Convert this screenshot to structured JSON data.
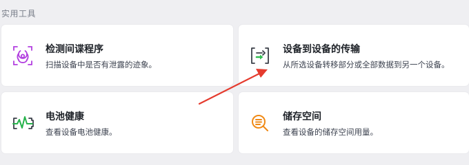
{
  "section": {
    "title": "实用工具"
  },
  "cards": [
    {
      "title": "检测间谍程序",
      "desc": "扫描设备中是否有泄露的迹象。",
      "icon": "biohazard-icon"
    },
    {
      "title": "设备到设备的传输",
      "desc": "从所选设备转移部分或全部数据到另一个设备。",
      "icon": "transfer-icon"
    },
    {
      "title": "电池健康",
      "desc": "查看设备电池健康。",
      "icon": "battery-health-icon"
    },
    {
      "title": "储存空间",
      "desc": "查看设备的储存空间用量。",
      "icon": "storage-search-icon"
    }
  ],
  "colors": {
    "background": "#efeff2",
    "card": "#ffffff",
    "spyware_icon": "#b23fe0",
    "transfer_icon": "#2fbd4f",
    "battery_icon": "#25b24a",
    "storage_icon": "#f08a16",
    "annotation_arrow": "#e53b2e"
  }
}
